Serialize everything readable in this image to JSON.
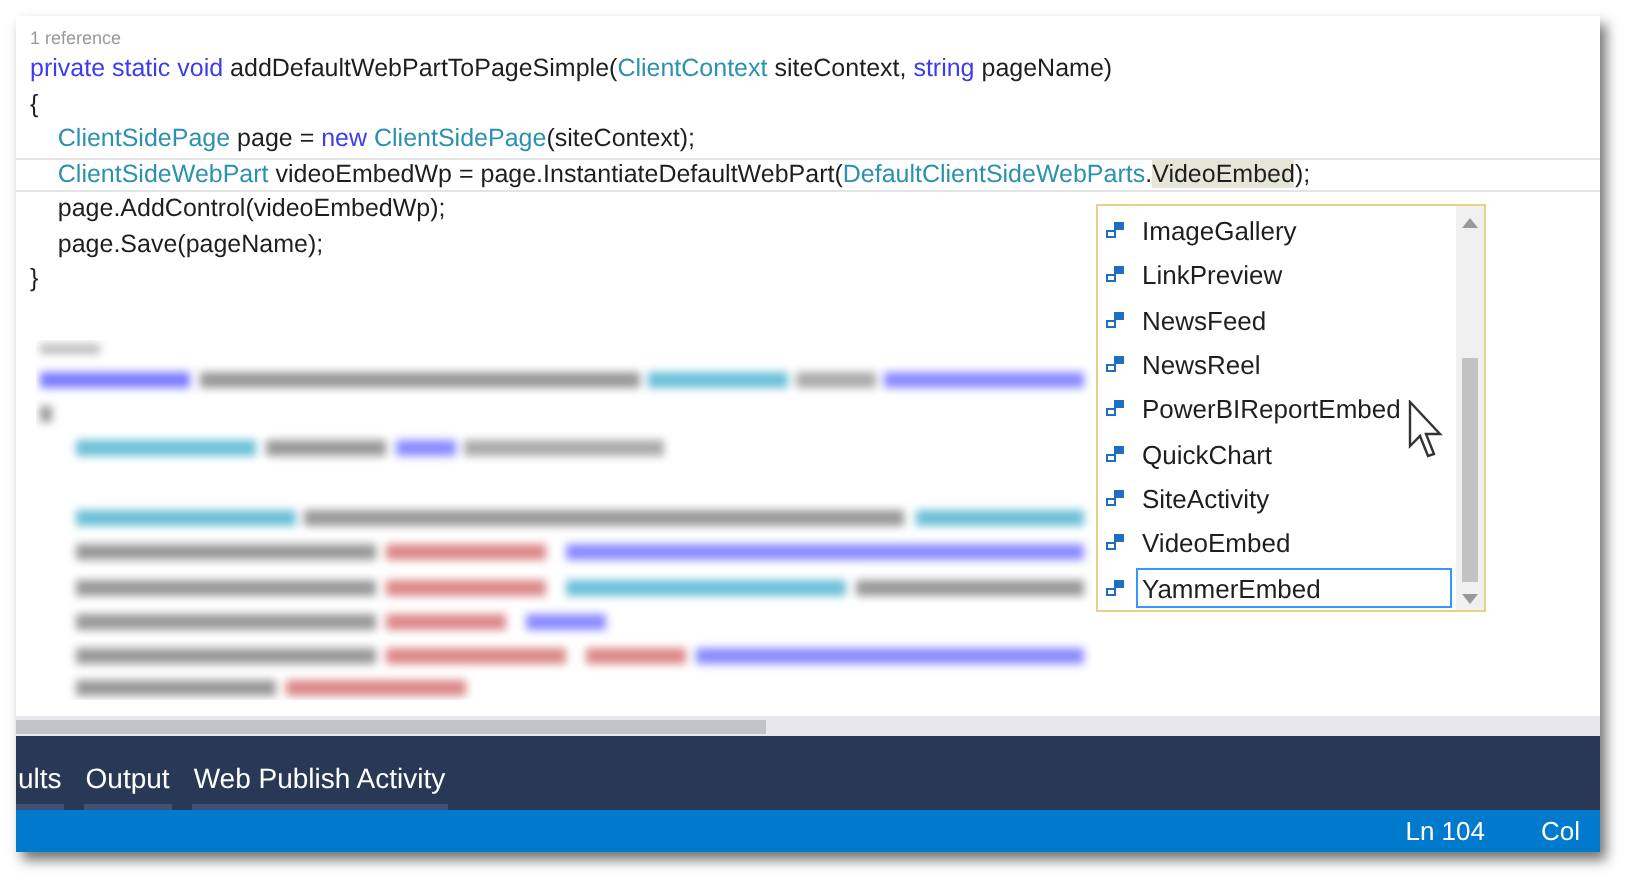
{
  "editor": {
    "codelens": "1 reference",
    "lines": [
      {
        "current": false,
        "tokens": [
          {
            "kind": "keyword",
            "text": "private static void"
          },
          {
            "kind": "plain",
            "text": " addDefaultWebPartToPageSimple("
          },
          {
            "kind": "type",
            "text": "ClientContext"
          },
          {
            "kind": "plain",
            "text": " siteContext, "
          },
          {
            "kind": "keyword",
            "text": "string"
          },
          {
            "kind": "plain",
            "text": " pageName)"
          }
        ]
      },
      {
        "current": false,
        "tokens": [
          {
            "kind": "plain",
            "text": "{"
          }
        ]
      },
      {
        "current": false,
        "tokens": [
          {
            "kind": "type",
            "text": "    ClientSidePage"
          },
          {
            "kind": "plain",
            "text": " page = "
          },
          {
            "kind": "keyword",
            "text": "new"
          },
          {
            "kind": "type",
            "text": " ClientSidePage"
          },
          {
            "kind": "plain",
            "text": "(siteContext);"
          }
        ]
      },
      {
        "current": true,
        "tokens": [
          {
            "kind": "type",
            "text": "    ClientSideWebPart"
          },
          {
            "kind": "plain",
            "text": " videoEmbedWp = page.InstantiateDefaultWebPart("
          },
          {
            "kind": "type",
            "text": "DefaultClientSideWebParts"
          },
          {
            "kind": "plain",
            "text": "."
          },
          {
            "kind": "match",
            "text": "VideoEmbed"
          },
          {
            "kind": "plain",
            "text": ");"
          }
        ]
      },
      {
        "current": false,
        "tokens": [
          {
            "kind": "plain",
            "text": "    page.AddControl(videoEmbedWp);"
          }
        ]
      },
      {
        "current": false,
        "tokens": [
          {
            "kind": "plain",
            "text": "    page.Save(pageName);"
          }
        ]
      },
      {
        "current": false,
        "tokens": [
          {
            "kind": "plain",
            "text": "}"
          }
        ]
      }
    ]
  },
  "completion_list": {
    "items": [
      {
        "label": "ImageGallery",
        "selected": false
      },
      {
        "label": "LinkPreview",
        "selected": false
      },
      {
        "label": "NewsFeed",
        "selected": false
      },
      {
        "label": "NewsReel",
        "selected": false
      },
      {
        "label": "PowerBIReportEmbed",
        "selected": false
      },
      {
        "label": "QuickChart",
        "selected": false
      },
      {
        "label": "SiteActivity",
        "selected": false
      },
      {
        "label": "VideoEmbed",
        "selected": false
      },
      {
        "label": "YammerEmbed",
        "selected": true
      }
    ]
  },
  "panel_tabs": [
    {
      "label": "ults"
    },
    {
      "label": "Output"
    },
    {
      "label": "Web Publish Activity"
    }
  ],
  "status_bar": [
    "Ln 104",
    "Col"
  ]
}
